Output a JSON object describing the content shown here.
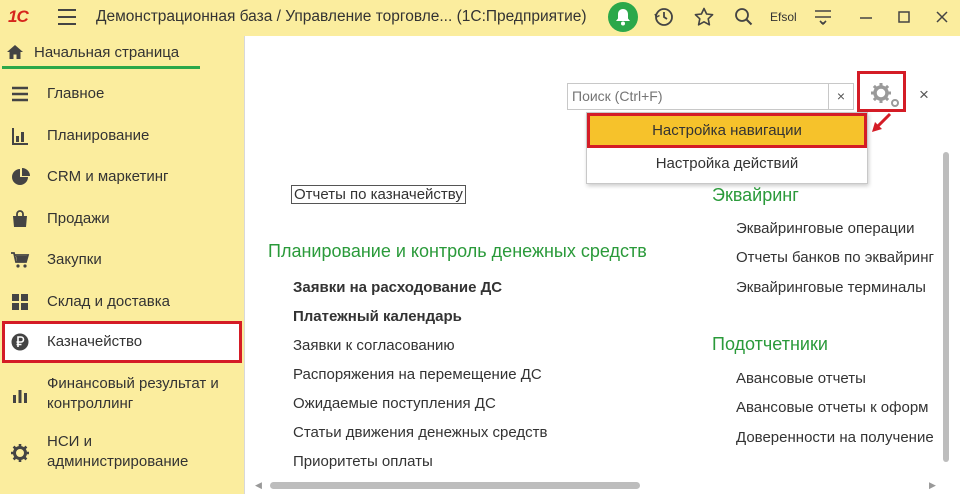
{
  "titlebar": {
    "logo": "1С",
    "title": "Демонстрационная база / Управление торговле... (1С:Предприятие)",
    "user": "Efsol"
  },
  "home_tab": {
    "label": "Начальная страница"
  },
  "sidebar": {
    "items": [
      {
        "label": "Главное",
        "icon": "menu-lines-icon"
      },
      {
        "label": "Планирование",
        "icon": "planning-chart-icon"
      },
      {
        "label": "CRM и маркетинг",
        "icon": "pie-chart-icon"
      },
      {
        "label": "Продажи",
        "icon": "shopping-bag-icon"
      },
      {
        "label": "Закупки",
        "icon": "cart-icon"
      },
      {
        "label": "Склад и доставка",
        "icon": "warehouse-grid-icon"
      },
      {
        "label": "Казначейство",
        "icon": "ruble-coin-icon",
        "active": true
      },
      {
        "label": "Финансовый результат и контроллинг",
        "icon": "bar-chart-icon"
      },
      {
        "label": "НСИ и администрирование",
        "icon": "gear-icon"
      }
    ]
  },
  "search": {
    "placeholder": "Поиск (Ctrl+F)",
    "clear": "×"
  },
  "close_panel": "×",
  "settings_menu": {
    "items": [
      "Настройка навигации",
      "Настройка действий"
    ],
    "highlighted_index": 0
  },
  "content": {
    "reports_link": "Отчеты по казначейству",
    "planning": {
      "title": "Планирование и контроль денежных средств",
      "bold_items": [
        "Заявки на расходование ДС",
        "Платежный календарь"
      ],
      "items": [
        "Заявки к согласованию",
        "Распоряжения на перемещение ДС",
        "Ожидаемые поступления ДС",
        "Статьи движения денежных средств",
        "Приоритеты оплаты"
      ]
    },
    "acquiring": {
      "title": "Эквайринг",
      "items": [
        "Эквайринговые операции",
        "Отчеты банков по эквайринг",
        "Эквайринговые терминалы"
      ]
    },
    "accountables": {
      "title": "Подотчетники",
      "items": [
        "Авансовые отчеты",
        "Авансовые отчеты к оформ",
        "Доверенности на получение"
      ]
    }
  },
  "colors": {
    "sidebar_bg": "#fbed9e",
    "accent_green": "#2a9a3a",
    "highlight_red": "#d41c26",
    "menu_highlight": "#f6c22b",
    "bell_green": "#2ba84a",
    "logo_red": "#d6261c"
  }
}
